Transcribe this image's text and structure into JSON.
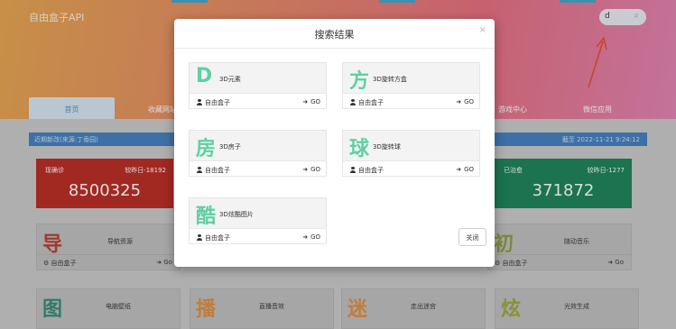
{
  "site": {
    "title": "自由盒子API"
  },
  "search": {
    "value": "d",
    "icon": "search-icon"
  },
  "nav": {
    "tabs": [
      {
        "label": "首页"
      },
      {
        "label": "收藏网站"
      },
      {
        "label": "游戏中心"
      },
      {
        "label": "微信应用"
      }
    ]
  },
  "notice": {
    "left": "近期新改(来源:丁香园)",
    "right": "截至 2022-11-21 9:24:12"
  },
  "stats": [
    {
      "label": "现确诊",
      "compare": "较昨日-18192",
      "value": "8500325",
      "color": "#b9241d"
    },
    {
      "label": "已治愈",
      "compare": "较昨日-1277",
      "value": "371872",
      "color": "#147f54"
    }
  ],
  "bg_cards": [
    {
      "glyph": "导",
      "name": "导航资源",
      "color": "#b33a2e",
      "author": "自由盒子",
      "go": "Go"
    },
    {
      "glyph": "初",
      "name": "随动音乐",
      "color": "#8a9a3a",
      "author": "自由盒子",
      "go": "Go"
    },
    {
      "glyph": "图",
      "name": "电脑壁纸",
      "color": "#2c8a72"
    },
    {
      "glyph": "播",
      "name": "直播音效",
      "color": "#e08a3a"
    },
    {
      "glyph": "迷",
      "name": "走出迷宫",
      "color": "#e08a3a"
    },
    {
      "glyph": "炫",
      "name": "光效生成",
      "color": "#9aa535"
    }
  ],
  "modal": {
    "title": "搜索结果",
    "close_icon": "×",
    "results": [
      {
        "glyph": "D",
        "name": "3D元素",
        "author": "自由盒子",
        "go": "GO"
      },
      {
        "glyph": "方",
        "name": "3D旋转方盒",
        "author": "自由盒子",
        "go": "GO"
      },
      {
        "glyph": "房",
        "name": "3D房子",
        "author": "自由盒子",
        "go": "GO"
      },
      {
        "glyph": "球",
        "name": "3D旋转球",
        "author": "自由盒子",
        "go": "GO"
      },
      {
        "glyph": "酷",
        "name": "3D炫酷图片",
        "author": "自由盒子",
        "go": "GO"
      }
    ],
    "close_label": "关闭"
  }
}
